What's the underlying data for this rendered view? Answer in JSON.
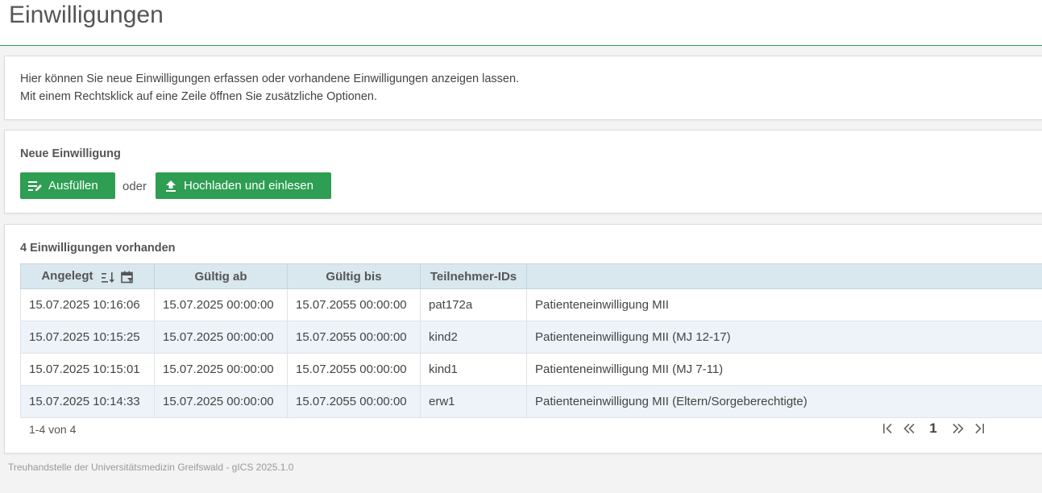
{
  "header": {
    "title": "Einwilligungen"
  },
  "info": {
    "line1": "Hier können Sie neue Einwilligungen erfassen oder vorhandene Einwilligungen anzeigen lassen.",
    "line2": "Mit einem Rechtsklick auf eine Zeile öffnen Sie zusätzliche Optionen."
  },
  "new_consent": {
    "title": "Neue Einwilligung",
    "fill_label": "Ausfüllen",
    "or_label": "oder",
    "upload_label": "Hochladen und einlesen"
  },
  "consent_list": {
    "title": "4 Einwilligungen vorhanden",
    "columns": [
      "Angelegt",
      "Gültig ab",
      "Gültig bis",
      "Teilnehmer-IDs",
      ""
    ],
    "rows": [
      [
        "15.07.2025 10:16:06",
        "15.07.2025 00:00:00",
        "15.07.2055 00:00:00",
        "pat172a",
        "Patienteneinwilligung MII"
      ],
      [
        "15.07.2025 10:15:25",
        "15.07.2025 00:00:00",
        "15.07.2055 00:00:00",
        "kind2",
        "Patienteneinwilligung MII (MJ 12-17)"
      ],
      [
        "15.07.2025 10:15:01",
        "15.07.2025 00:00:00",
        "15.07.2055 00:00:00",
        "kind1",
        "Patienteneinwilligung MII (MJ 7-11)"
      ],
      [
        "15.07.2025 10:14:33",
        "15.07.2025 00:00:00",
        "15.07.2055 00:00:00",
        "erw1",
        "Patienteneinwilligung MII (Eltern/Sorgeberechtigte)"
      ]
    ],
    "paginator": {
      "summary": "1-4 von 4",
      "current_page": "1"
    }
  },
  "footer": {
    "text": "Treuhandstelle der Universitätsmedizin Greifswald - gICS 2025.1.0"
  },
  "colors": {
    "accent": "#2e9e53",
    "table_header": "#d9e7ef",
    "row_alt": "#eef3f9"
  },
  "icons": [
    "edit-form-icon",
    "upload-icon",
    "sort-descending-icon",
    "calendar-filter-icon",
    "first-page-icon",
    "prev-page-icon",
    "next-page-icon",
    "last-page-icon"
  ]
}
